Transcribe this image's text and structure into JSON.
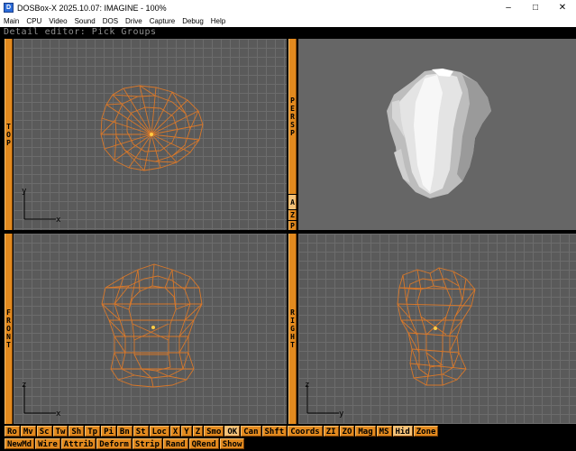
{
  "window": {
    "title": "DOSBox-X 2025.10.07: IMAGINE - 100%"
  },
  "menu": [
    "Main",
    "CPU",
    "Video",
    "Sound",
    "DOS",
    "Drive",
    "Capture",
    "Debug",
    "Help"
  ],
  "status_line": "Detail editor: Pick Groups",
  "views": {
    "top": {
      "label": [
        "T",
        "O",
        "P"
      ],
      "axis_v": "y",
      "axis_h": "x"
    },
    "persp": {
      "label": [
        "P",
        "E",
        "R",
        "S",
        "P"
      ],
      "az": [
        "A",
        "Z"
      ],
      "p": "P"
    },
    "front": {
      "label": [
        "F",
        "R",
        "O",
        "N",
        "T"
      ],
      "axis_v": "z",
      "axis_h": "x"
    },
    "right": {
      "label": [
        "R",
        "I",
        "G",
        "H",
        "T"
      ],
      "axis_v": "z",
      "axis_h": "y"
    }
  },
  "toolbar_row1": [
    "Ro",
    "Mv",
    "Sc",
    "Tw",
    "Sh",
    "Tp",
    "Pi",
    "Bn",
    "St",
    "Loc",
    "X",
    "Y",
    "Z",
    "Smo",
    "OK",
    "Can",
    "Shft",
    "Coords",
    "ZI",
    "ZO",
    "Mag",
    "MS",
    "Hid",
    "Zone"
  ],
  "toolbar_row2": [
    "NewMd",
    "Wire",
    "Attrib",
    "Deform",
    "Strip",
    "Rand",
    "QRend",
    "Show"
  ],
  "colors": {
    "wire": "#d8782a",
    "button": "#e28a1f",
    "grid_bg": "#5a5a5a",
    "grid_line": "#6c6c6c",
    "persp_bg": "#666666"
  },
  "icons": {
    "app": "dosbox-icon",
    "minimize": "minimize-icon",
    "maximize": "maximize-icon",
    "close": "close-icon"
  }
}
